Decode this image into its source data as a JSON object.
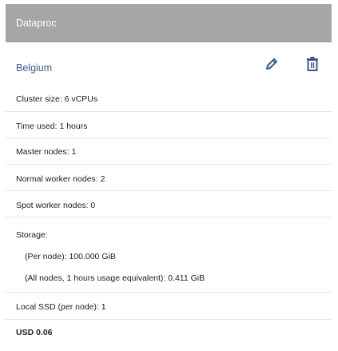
{
  "card": {
    "title": "Dataproc",
    "region": "Belgium",
    "icons": {
      "edit": "pencil-icon",
      "delete": "trash-icon"
    },
    "rows": {
      "cluster_size": "Cluster size: 6 vCPUs",
      "time_used": "Time used: 1 hours",
      "master_nodes": "Master nodes: 1",
      "normal_workers": "Normal worker nodes: 2",
      "spot_workers": "Spot worker nodes: 0",
      "storage_label": "Storage:",
      "storage_per_node": "(Per node): 100.000 GiB",
      "storage_all_nodes": "(All nodes, 1 hours usage equivalent): 0.411 GiB",
      "local_ssd": "Local SSD (per node): 1",
      "total": "USD 0.06"
    },
    "colors": {
      "header_bg": "#a6a6a6",
      "accent": "#3b5a86"
    }
  }
}
